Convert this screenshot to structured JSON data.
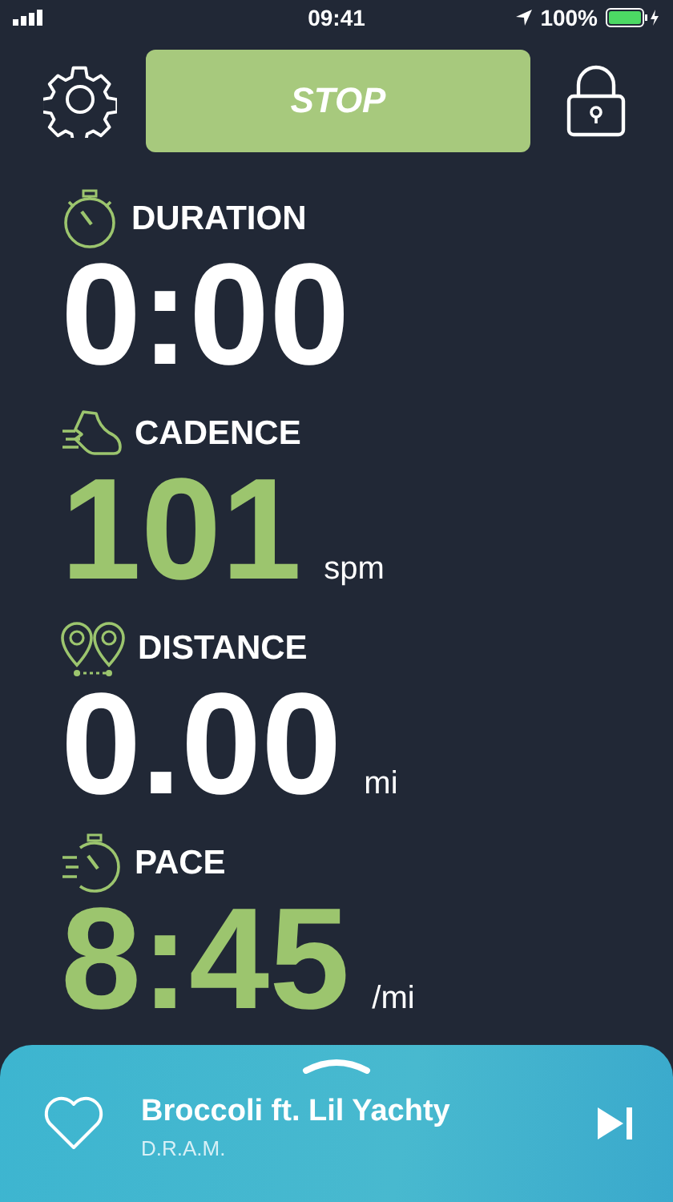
{
  "status_bar": {
    "time": "09:41",
    "battery": "100%"
  },
  "top_bar": {
    "button": "STOP"
  },
  "metrics": [
    {
      "kind": "stopwatch",
      "label": "DURATION",
      "value": "0:00",
      "color": "#ffffff"
    },
    {
      "kind": "shoe",
      "label": "CADENCE",
      "value": "101",
      "unit": "spm",
      "color": "#9cc56e"
    },
    {
      "kind": "pins",
      "label": "DISTANCE",
      "value": "0.00",
      "unit": "mi",
      "color": "#ffffff"
    },
    {
      "kind": "fast-stopwatch",
      "label": "PACE",
      "value": "8:45",
      "unit": "/mi",
      "color": "#9cc56e"
    }
  ],
  "player": {
    "title": "Broccoli ft. Lil Yachty",
    "artist": "D.R.A.M."
  }
}
